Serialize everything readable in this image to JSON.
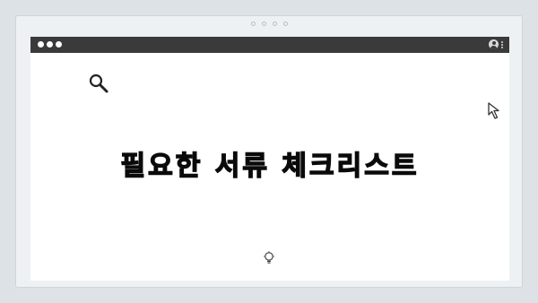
{
  "slide": {
    "title": "필요한 서류 체크리스트"
  },
  "icons": {
    "search": "search-icon",
    "cursor": "cursor-arrow-icon",
    "lightbulb": "lightbulb-icon",
    "user": "user-icon",
    "menu": "kebab-menu-icon"
  },
  "colors": {
    "background": "#dde2e7",
    "frame": "#eef1f3",
    "titlebar": "#3a3a3a",
    "window": "#ffffff",
    "title_text": "#0a0a0a"
  }
}
